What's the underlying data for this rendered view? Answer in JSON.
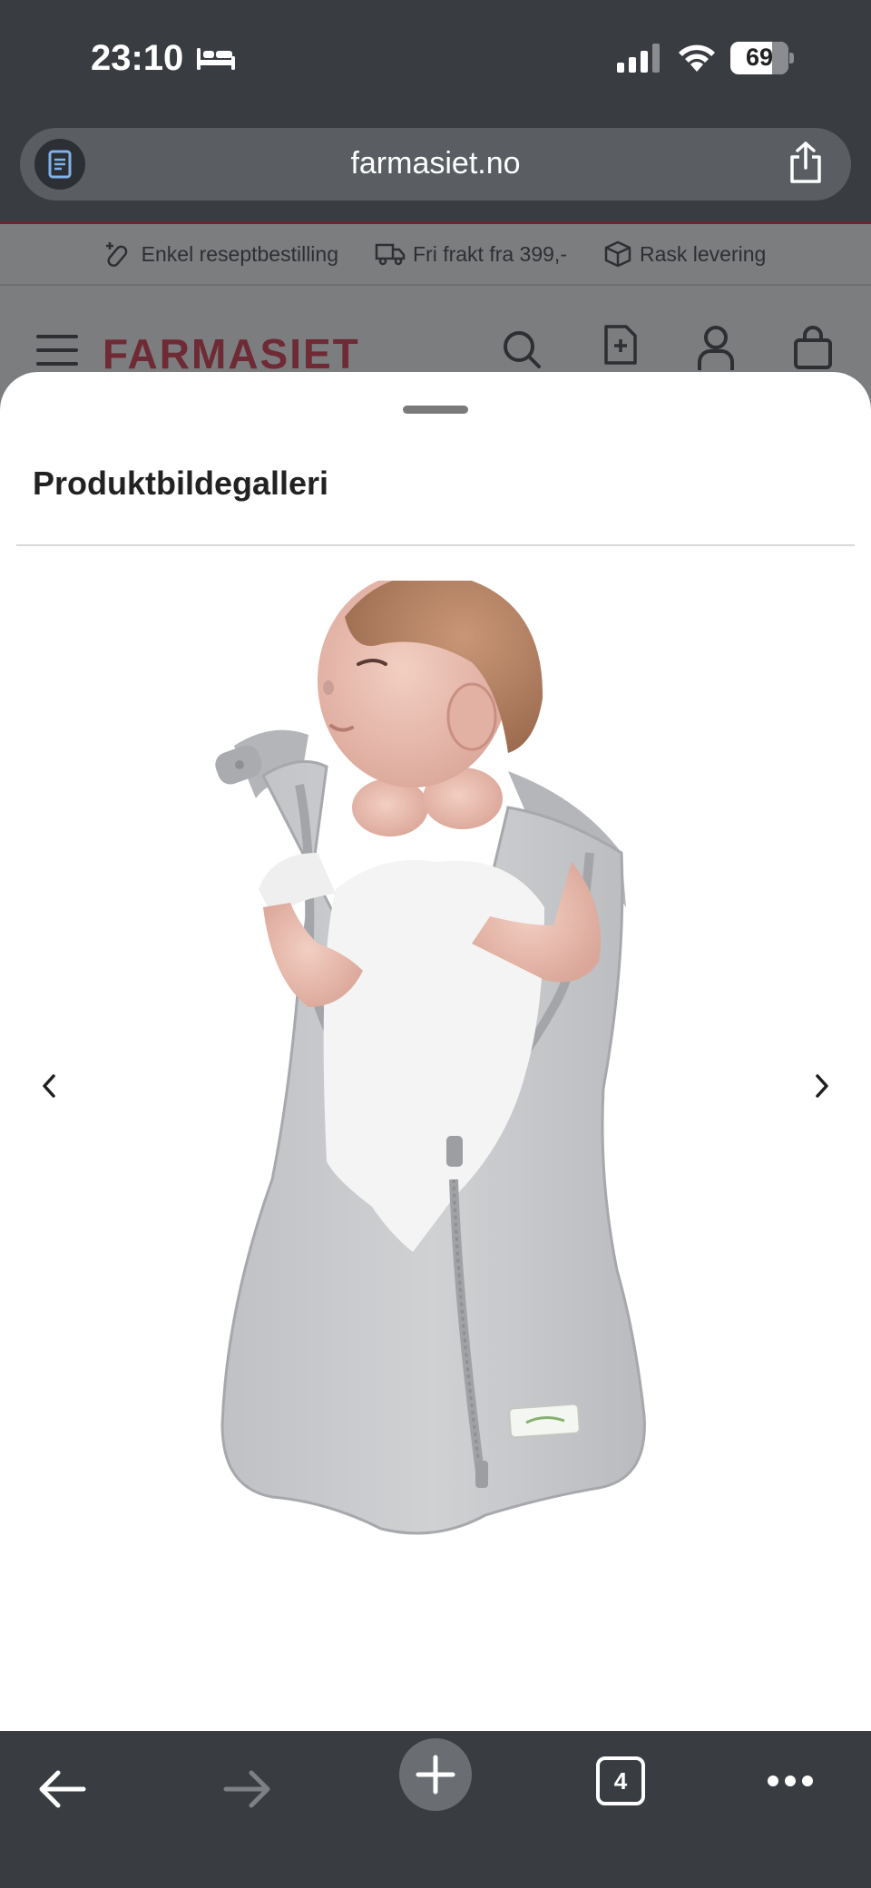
{
  "status_bar": {
    "time": "23:10",
    "battery_percent": "69",
    "icons": [
      "bed-icon",
      "signal-icon",
      "wifi-icon",
      "battery-icon"
    ]
  },
  "browser": {
    "url": "farmasiet.no",
    "icons": [
      "reader-icon",
      "share-icon"
    ]
  },
  "site": {
    "usp": [
      {
        "icon": "prescription-icon",
        "label": "Enkel reseptbestilling"
      },
      {
        "icon": "truck-icon",
        "label": "Fri frakt fra 399,-"
      },
      {
        "icon": "package-icon",
        "label": "Rask levering"
      }
    ],
    "logo": "FARMASIET",
    "header_icons": [
      "menu-icon",
      "search-icon",
      "prescription-doc-icon",
      "account-icon",
      "cart-icon"
    ],
    "accent_color": "#7a2332"
  },
  "sheet": {
    "title": "Produktbildegalleri",
    "image_alt": "Newborn baby in grey swaddle sleeping bag with zipper",
    "nav": [
      "previous-icon",
      "next-icon"
    ]
  },
  "toolbar": {
    "tab_count": "4",
    "icons": [
      "back-icon",
      "forward-icon",
      "new-tab-icon",
      "tabs-icon",
      "more-icon"
    ]
  }
}
